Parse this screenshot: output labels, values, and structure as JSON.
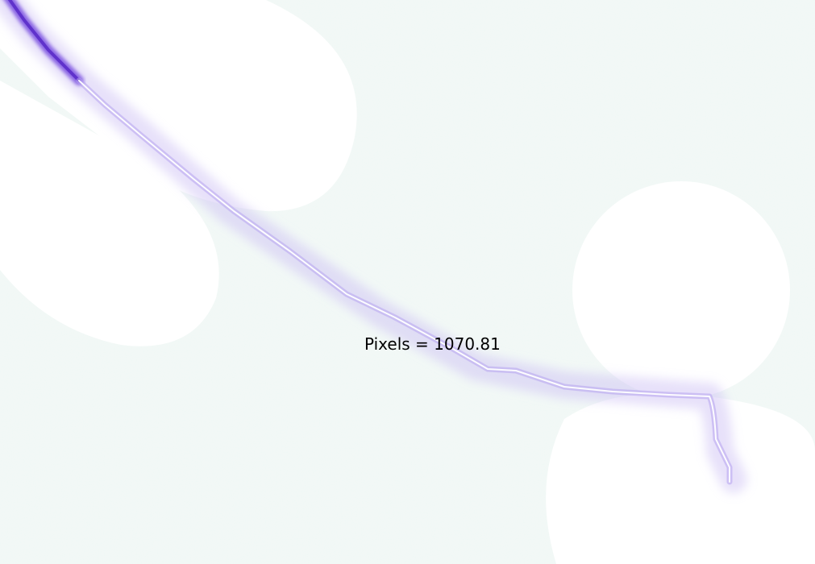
{
  "measurement": {
    "label": "Pixels = 1070.81"
  },
  "colors": {
    "background": "#ffffff",
    "texture": "#e3f1ec",
    "trace_glow": "#b7a4ef",
    "trace_core": "#6b3fd6",
    "label_text": "#000000"
  }
}
